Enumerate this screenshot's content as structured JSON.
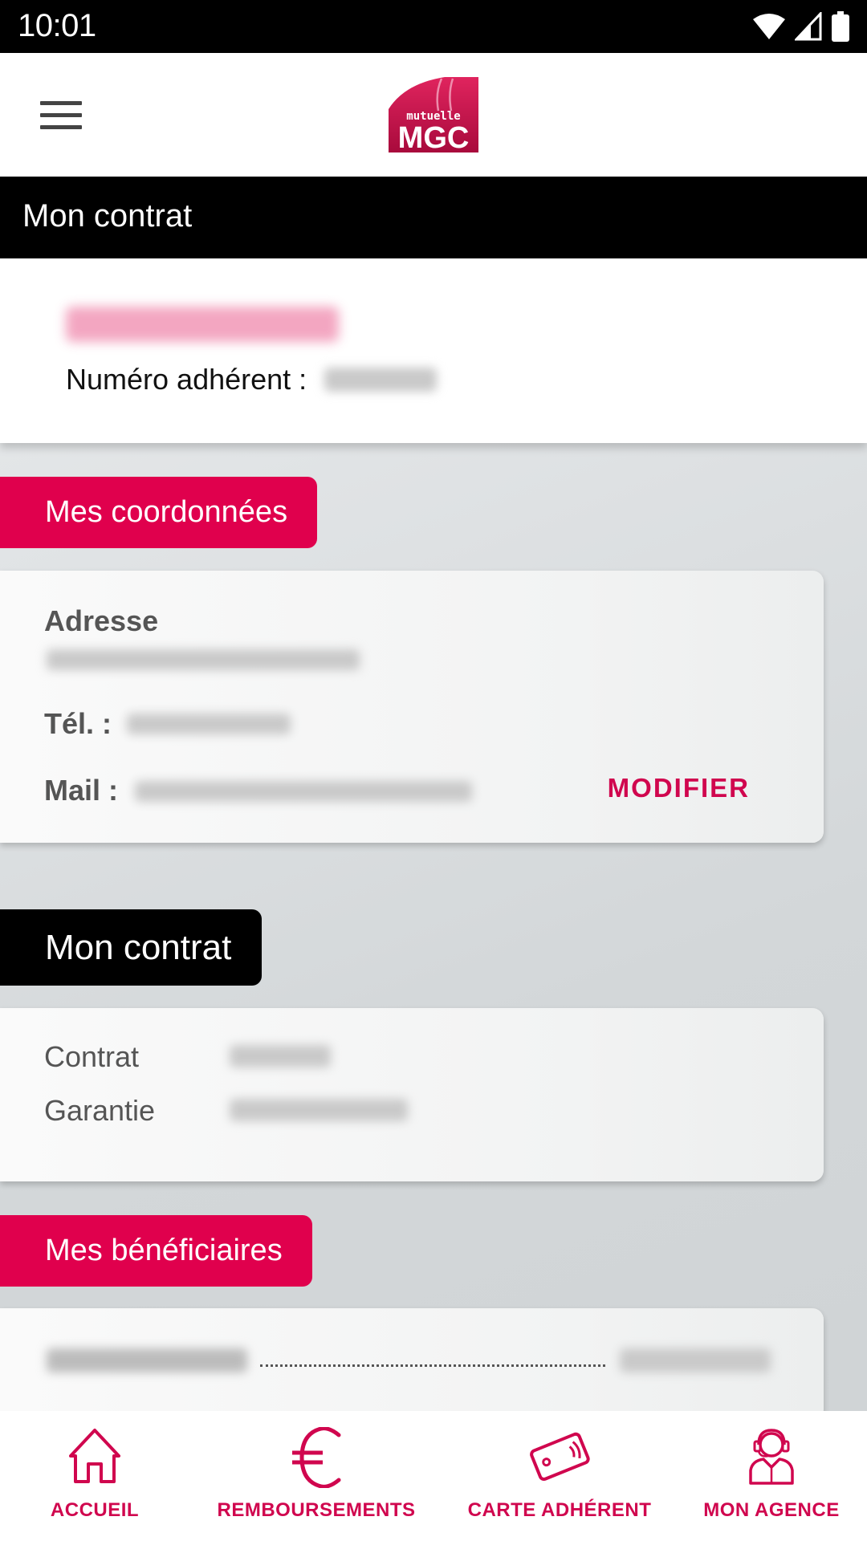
{
  "status_bar": {
    "time": "10:01",
    "icons": [
      "wifi-icon",
      "signal-icon",
      "battery-icon"
    ]
  },
  "header": {
    "menu_icon": "hamburger-menu-icon",
    "logo": {
      "line1": "mutuelle",
      "line2": "MGC",
      "color": "#c8104a"
    }
  },
  "page": {
    "title": "Mon contrat"
  },
  "profile": {
    "name": "",
    "member_number_label": "Numéro adhérent :",
    "member_number": ""
  },
  "sections": {
    "coordonnees": {
      "title": "Mes coordonnées",
      "address_label": "Adresse",
      "address_value": "",
      "phone_label": "Tél. :",
      "phone_value": "",
      "mail_label": "Mail :",
      "mail_value": "",
      "modify_button": "MODIFIER"
    },
    "contrat": {
      "title": "Mon contrat",
      "contract_label": "Contrat",
      "contract_value": "",
      "guarantee_label": "Garantie",
      "guarantee_value": ""
    },
    "beneficiaires": {
      "title": "Mes bénéficiaires",
      "items": [
        {
          "name": "",
          "date": ""
        }
      ]
    }
  },
  "bottom_nav": {
    "items": [
      {
        "label": "ACCUEIL",
        "icon": "home-icon"
      },
      {
        "label": "REMBOURSEMENTS",
        "icon": "euro-icon"
      },
      {
        "label": "CARTE ADHÉRENT",
        "icon": "member-card-icon"
      },
      {
        "label": "MON AGENCE",
        "icon": "agent-headset-icon"
      }
    ]
  },
  "colors": {
    "accent": "#e0004d",
    "accent_text": "#d0064e",
    "header_bg": "#000000"
  }
}
